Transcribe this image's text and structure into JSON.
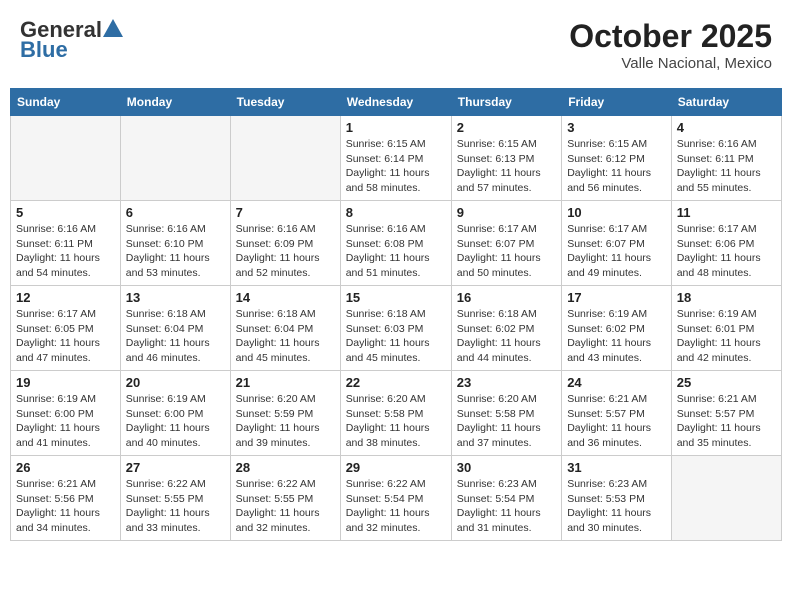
{
  "header": {
    "logo_general": "General",
    "logo_blue": "Blue",
    "month_title": "October 2025",
    "location": "Valle Nacional, Mexico"
  },
  "days_of_week": [
    "Sunday",
    "Monday",
    "Tuesday",
    "Wednesday",
    "Thursday",
    "Friday",
    "Saturday"
  ],
  "weeks": [
    [
      {
        "day": "",
        "sunrise": "",
        "sunset": "",
        "daylight": "",
        "empty": true
      },
      {
        "day": "",
        "sunrise": "",
        "sunset": "",
        "daylight": "",
        "empty": true
      },
      {
        "day": "",
        "sunrise": "",
        "sunset": "",
        "daylight": "",
        "empty": true
      },
      {
        "day": "1",
        "sunrise": "Sunrise: 6:15 AM",
        "sunset": "Sunset: 6:14 PM",
        "daylight": "Daylight: 11 hours and 58 minutes."
      },
      {
        "day": "2",
        "sunrise": "Sunrise: 6:15 AM",
        "sunset": "Sunset: 6:13 PM",
        "daylight": "Daylight: 11 hours and 57 minutes."
      },
      {
        "day": "3",
        "sunrise": "Sunrise: 6:15 AM",
        "sunset": "Sunset: 6:12 PM",
        "daylight": "Daylight: 11 hours and 56 minutes."
      },
      {
        "day": "4",
        "sunrise": "Sunrise: 6:16 AM",
        "sunset": "Sunset: 6:11 PM",
        "daylight": "Daylight: 11 hours and 55 minutes."
      }
    ],
    [
      {
        "day": "5",
        "sunrise": "Sunrise: 6:16 AM",
        "sunset": "Sunset: 6:11 PM",
        "daylight": "Daylight: 11 hours and 54 minutes."
      },
      {
        "day": "6",
        "sunrise": "Sunrise: 6:16 AM",
        "sunset": "Sunset: 6:10 PM",
        "daylight": "Daylight: 11 hours and 53 minutes."
      },
      {
        "day": "7",
        "sunrise": "Sunrise: 6:16 AM",
        "sunset": "Sunset: 6:09 PM",
        "daylight": "Daylight: 11 hours and 52 minutes."
      },
      {
        "day": "8",
        "sunrise": "Sunrise: 6:16 AM",
        "sunset": "Sunset: 6:08 PM",
        "daylight": "Daylight: 11 hours and 51 minutes."
      },
      {
        "day": "9",
        "sunrise": "Sunrise: 6:17 AM",
        "sunset": "Sunset: 6:07 PM",
        "daylight": "Daylight: 11 hours and 50 minutes."
      },
      {
        "day": "10",
        "sunrise": "Sunrise: 6:17 AM",
        "sunset": "Sunset: 6:07 PM",
        "daylight": "Daylight: 11 hours and 49 minutes."
      },
      {
        "day": "11",
        "sunrise": "Sunrise: 6:17 AM",
        "sunset": "Sunset: 6:06 PM",
        "daylight": "Daylight: 11 hours and 48 minutes."
      }
    ],
    [
      {
        "day": "12",
        "sunrise": "Sunrise: 6:17 AM",
        "sunset": "Sunset: 6:05 PM",
        "daylight": "Daylight: 11 hours and 47 minutes."
      },
      {
        "day": "13",
        "sunrise": "Sunrise: 6:18 AM",
        "sunset": "Sunset: 6:04 PM",
        "daylight": "Daylight: 11 hours and 46 minutes."
      },
      {
        "day": "14",
        "sunrise": "Sunrise: 6:18 AM",
        "sunset": "Sunset: 6:04 PM",
        "daylight": "Daylight: 11 hours and 45 minutes."
      },
      {
        "day": "15",
        "sunrise": "Sunrise: 6:18 AM",
        "sunset": "Sunset: 6:03 PM",
        "daylight": "Daylight: 11 hours and 45 minutes."
      },
      {
        "day": "16",
        "sunrise": "Sunrise: 6:18 AM",
        "sunset": "Sunset: 6:02 PM",
        "daylight": "Daylight: 11 hours and 44 minutes."
      },
      {
        "day": "17",
        "sunrise": "Sunrise: 6:19 AM",
        "sunset": "Sunset: 6:02 PM",
        "daylight": "Daylight: 11 hours and 43 minutes."
      },
      {
        "day": "18",
        "sunrise": "Sunrise: 6:19 AM",
        "sunset": "Sunset: 6:01 PM",
        "daylight": "Daylight: 11 hours and 42 minutes."
      }
    ],
    [
      {
        "day": "19",
        "sunrise": "Sunrise: 6:19 AM",
        "sunset": "Sunset: 6:00 PM",
        "daylight": "Daylight: 11 hours and 41 minutes."
      },
      {
        "day": "20",
        "sunrise": "Sunrise: 6:19 AM",
        "sunset": "Sunset: 6:00 PM",
        "daylight": "Daylight: 11 hours and 40 minutes."
      },
      {
        "day": "21",
        "sunrise": "Sunrise: 6:20 AM",
        "sunset": "Sunset: 5:59 PM",
        "daylight": "Daylight: 11 hours and 39 minutes."
      },
      {
        "day": "22",
        "sunrise": "Sunrise: 6:20 AM",
        "sunset": "Sunset: 5:58 PM",
        "daylight": "Daylight: 11 hours and 38 minutes."
      },
      {
        "day": "23",
        "sunrise": "Sunrise: 6:20 AM",
        "sunset": "Sunset: 5:58 PM",
        "daylight": "Daylight: 11 hours and 37 minutes."
      },
      {
        "day": "24",
        "sunrise": "Sunrise: 6:21 AM",
        "sunset": "Sunset: 5:57 PM",
        "daylight": "Daylight: 11 hours and 36 minutes."
      },
      {
        "day": "25",
        "sunrise": "Sunrise: 6:21 AM",
        "sunset": "Sunset: 5:57 PM",
        "daylight": "Daylight: 11 hours and 35 minutes."
      }
    ],
    [
      {
        "day": "26",
        "sunrise": "Sunrise: 6:21 AM",
        "sunset": "Sunset: 5:56 PM",
        "daylight": "Daylight: 11 hours and 34 minutes."
      },
      {
        "day": "27",
        "sunrise": "Sunrise: 6:22 AM",
        "sunset": "Sunset: 5:55 PM",
        "daylight": "Daylight: 11 hours and 33 minutes."
      },
      {
        "day": "28",
        "sunrise": "Sunrise: 6:22 AM",
        "sunset": "Sunset: 5:55 PM",
        "daylight": "Daylight: 11 hours and 32 minutes."
      },
      {
        "day": "29",
        "sunrise": "Sunrise: 6:22 AM",
        "sunset": "Sunset: 5:54 PM",
        "daylight": "Daylight: 11 hours and 32 minutes."
      },
      {
        "day": "30",
        "sunrise": "Sunrise: 6:23 AM",
        "sunset": "Sunset: 5:54 PM",
        "daylight": "Daylight: 11 hours and 31 minutes."
      },
      {
        "day": "31",
        "sunrise": "Sunrise: 6:23 AM",
        "sunset": "Sunset: 5:53 PM",
        "daylight": "Daylight: 11 hours and 30 minutes."
      },
      {
        "day": "",
        "sunrise": "",
        "sunset": "",
        "daylight": "",
        "empty": true
      }
    ]
  ]
}
